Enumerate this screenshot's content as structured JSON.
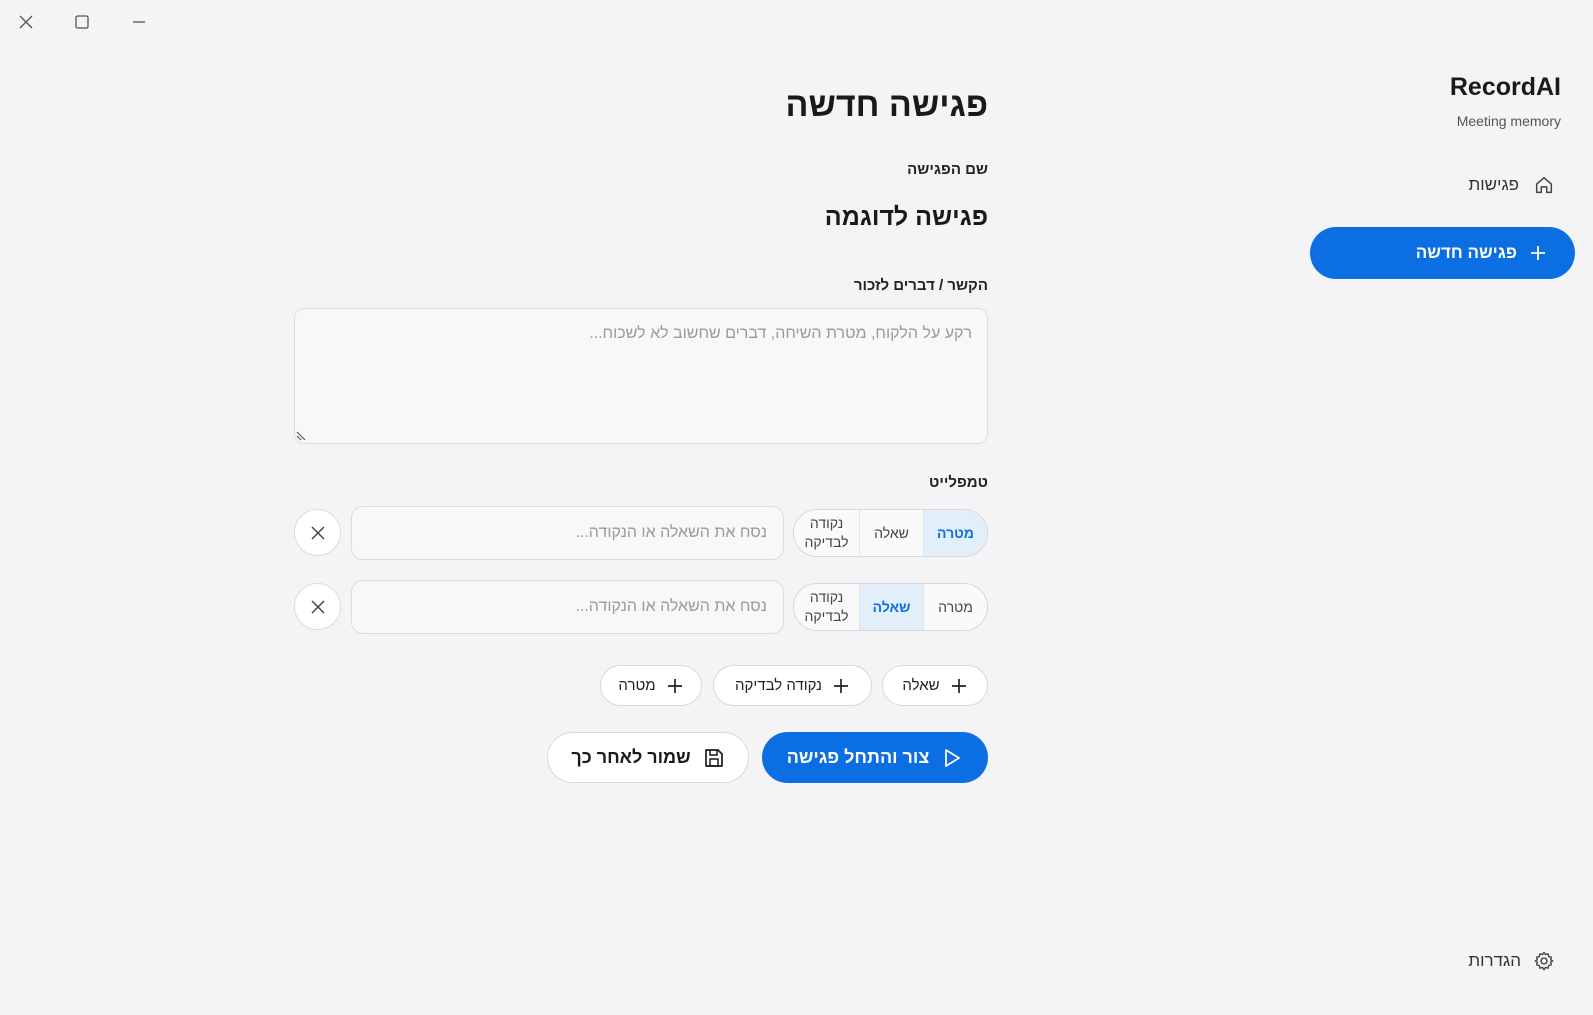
{
  "window": {
    "controls": [
      "close-icon",
      "maximize-icon",
      "minimize-icon"
    ]
  },
  "sidebar": {
    "brand": "RecordAI",
    "tagline": "Meeting memory",
    "nav_meetings": "פגישות",
    "new_meeting_button": "פגישה חדשה",
    "settings": "הגדרות"
  },
  "main": {
    "title": "פגישה חדשה",
    "meeting_name_label": "שם הפגישה",
    "meeting_name_value": "פגישה לדוגמה",
    "context_label": "הקשר / דברים לזכור",
    "context_placeholder": "רקע על הלקוח, מטרת השיחה, דברים שחשוב לא לשכוח...",
    "template_label": "טמפלייט",
    "template_rows": [
      {
        "types": {
          "goal": "מטרה",
          "question": "שאלה",
          "checkpoint": "נקודה לבדיקה"
        },
        "selected": "goal",
        "placeholder": "נסח את השאלה או הנקודה..."
      },
      {
        "types": {
          "goal": "מטרה",
          "question": "שאלה",
          "checkpoint": "נקודה לבדיקה"
        },
        "selected": "question",
        "placeholder": "נסח את השאלה או הנקודה..."
      }
    ],
    "add_buttons": {
      "question": "שאלה",
      "checkpoint": "נקודה לבדיקה",
      "goal": "מטרה"
    },
    "primary_action": "צור והתחל פגישה",
    "secondary_action": "שמור לאחר כך"
  },
  "colors": {
    "accent": "#0b6ee3",
    "background": "#f4f4f6",
    "selected_segment_bg": "#e3eefb"
  }
}
